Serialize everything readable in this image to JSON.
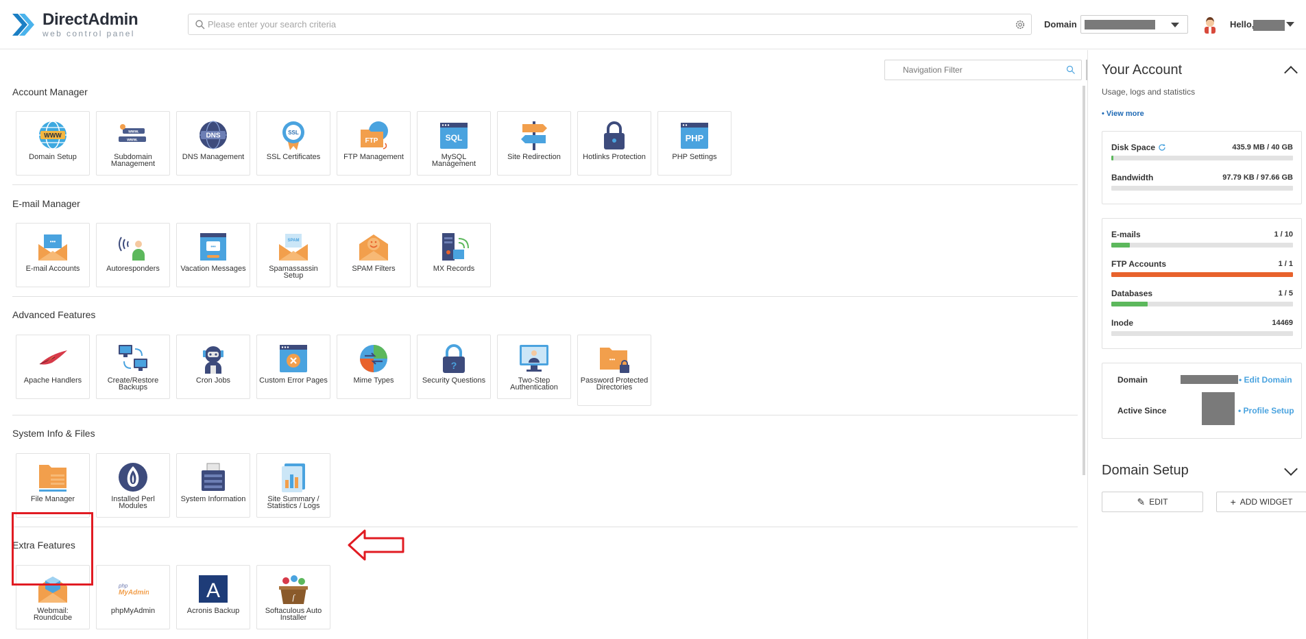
{
  "header": {
    "logo_title": "DirectAdmin",
    "logo_subtitle": "web control panel",
    "search_placeholder": "Please enter your search criteria",
    "domain_label": "Domain",
    "hello": "Hello,"
  },
  "nav_filter": {
    "placeholder": "Navigation Filter"
  },
  "sections": [
    {
      "title": "Account Manager",
      "items": [
        "Domain Setup",
        "Subdomain Management",
        "DNS Management",
        "SSL Certificates",
        "FTP Management",
        "MySQL Management",
        "Site Redirection",
        "Hotlinks Protection",
        "PHP Settings"
      ]
    },
    {
      "title": "E-mail Manager",
      "items": [
        "E-mail Accounts",
        "Autoresponders",
        "Vacation Messages",
        "Spamassassin Setup",
        "SPAM Filters",
        "MX Records"
      ]
    },
    {
      "title": "Advanced Features",
      "items": [
        "Apache Handlers",
        "Create/Restore Backups",
        "Cron Jobs",
        "Custom Error Pages",
        "Mime Types",
        "Security Questions",
        "Two-Step Authentication",
        "Password Protected Directories"
      ]
    },
    {
      "title": "System Info & Files",
      "items": [
        "File Manager",
        "Installed Perl Modules",
        "System Information",
        "Site Summary / Statistics / Logs"
      ]
    },
    {
      "title": "Extra Features",
      "items": [
        "Webmail: Roundcube",
        "phpMyAdmin",
        "Acronis Backup",
        "Softaculous Auto Installer"
      ]
    }
  ],
  "account": {
    "title": "Your Account",
    "subtitle": "Usage, logs and statistics",
    "view_more": "• View more",
    "usage": [
      {
        "name": "Disk Space",
        "value": "435.9 MB / 40 GB",
        "fraction": 0.011,
        "color": "#5cb85c"
      },
      {
        "name": "Bandwidth",
        "value": "97.79 KB / 97.66 GB",
        "fraction": 0.0,
        "color": "#5cb85c"
      }
    ],
    "limits": [
      {
        "name": "E-mails",
        "value": "1 / 10",
        "fraction": 0.1,
        "color": "#5cb85c"
      },
      {
        "name": "FTP Accounts",
        "value": "1 / 1",
        "fraction": 1.0,
        "color": "#e8622c"
      },
      {
        "name": "Databases",
        "value": "1 / 5",
        "fraction": 0.2,
        "color": "#5cb85c"
      },
      {
        "name": "Inode",
        "value": "14469",
        "fraction": 0.0,
        "color": "#5cb85c"
      }
    ],
    "domain_label": "Domain",
    "edit_domain": "• Edit Domain",
    "active_since_label": "Active Since",
    "profile_setup": "• Profile Setup"
  },
  "domain_setup_widget": {
    "title": "Domain Setup",
    "edit_label": "EDIT",
    "add_widget_label": "ADD WIDGET"
  },
  "icons": [
    "search-icon",
    "gear-icon",
    "avatar-icon",
    "www-globe-icon",
    "subdomain-icon",
    "dns-icon",
    "ssl-badge-icon",
    "ftp-folder-icon",
    "mysql-icon",
    "signpost-icon",
    "padlock-icon",
    "php-icon",
    "mail-icon",
    "autoresponder-icon",
    "vacation-icon",
    "spam-envelope-icon",
    "spam-filter-icon",
    "mx-server-icon",
    "feather-icon",
    "backup-computers-icon",
    "robot-icon",
    "error-page-icon",
    "mime-icon",
    "security-lock-icon",
    "two-step-icon",
    "protected-folder-icon",
    "folder-icon",
    "perl-onion-icon",
    "system-printer-icon",
    "stats-icon",
    "roundcube-icon",
    "phpmyadmin-icon",
    "acronis-icon",
    "softaculous-icon",
    "arrow-left-icon"
  ]
}
